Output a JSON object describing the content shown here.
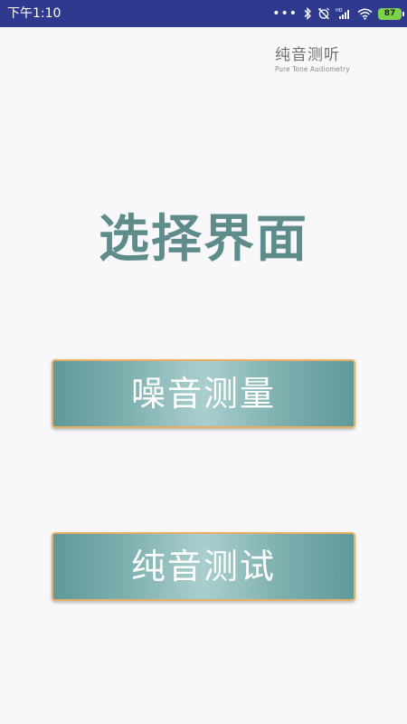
{
  "status_bar": {
    "time": "下午1:10",
    "dots": "•••",
    "battery": "87",
    "icons": [
      "bluetooth-icon",
      "alarm-off-icon",
      "signal-icon",
      "wifi-icon",
      "battery-icon"
    ],
    "background_color": "#2f3a8f"
  },
  "logo": {
    "title": "纯音测听",
    "subtitle": "Pure Tone Audiometry"
  },
  "page": {
    "title": "选择界面",
    "title_color": "#5e8c8a",
    "background_color": "#f8f7fa"
  },
  "buttons": {
    "noise_measure": "噪音测量",
    "pure_tone_test": "纯音测试",
    "border_color": "#e8ae62",
    "gradient_colors": [
      "#5f9999",
      "#a9cfcd"
    ]
  }
}
